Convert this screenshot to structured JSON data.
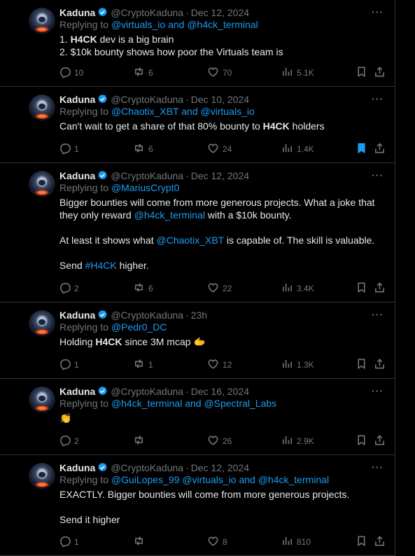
{
  "colors": {
    "background": "#000000",
    "text": "#e7e9ea",
    "muted": "#71767b",
    "link": "#1d9bf0",
    "border": "#2f3336"
  },
  "tweets": [
    {
      "name": "Kaduna",
      "handle": "@CryptoKaduna",
      "date": "Dec 12, 2024",
      "reply_prefix": "Replying to ",
      "reply_to": "@virtuals_io and @h4ck_terminal",
      "lines": [
        {
          "a": "1. ",
          "b": "H4CK",
          "c": " dev is a big brain"
        },
        {
          "a": "2. $10k bounty shows how poor the Virtuals team is"
        }
      ],
      "replies": "10",
      "retweets": "6",
      "likes": "70",
      "views": "5.1K",
      "bookmarked": false
    },
    {
      "name": "Kaduna",
      "handle": "@CryptoKaduna",
      "date": "Dec 10, 2024",
      "reply_prefix": "Replying to ",
      "reply_to": "@Chaotix_XBT and @virtuals_io",
      "lines": [
        {
          "a": "Can't wait to get a share of that 80% bounty to ",
          "b": "H4CK",
          "c": " holders"
        }
      ],
      "replies": "1",
      "retweets": "6",
      "likes": "24",
      "views": "1.4K",
      "bookmarked": true
    },
    {
      "name": "Kaduna",
      "handle": "@CryptoKaduna",
      "date": "Dec 12, 2024",
      "reply_prefix": "Replying to ",
      "reply_to": "@MariusCrypt0",
      "lines": [
        {
          "a": "Bigger bounties will come from more generous projects. What a joke that"
        },
        {
          "a": "they only reward ",
          "link": "@h4ck_terminal",
          "c": " with a $10k bounty."
        },
        {
          "gap": true
        },
        {
          "a": "At least it shows what ",
          "link": "@Chaotix_XBT",
          "c": " is capable of. The skill is valuable."
        },
        {
          "gap": true
        },
        {
          "a": "Send ",
          "link": "#H4CK",
          "c": " higher."
        }
      ],
      "replies": "2",
      "retweets": "6",
      "likes": "22",
      "views": "3.4K",
      "bookmarked": false
    },
    {
      "name": "Kaduna",
      "handle": "@CryptoKaduna",
      "date": "23h",
      "reply_prefix": "Replying to ",
      "reply_to": "@Pedr0_DC",
      "lines": [
        {
          "a": "Holding ",
          "b": "H4CK",
          "c": " since 3M mcap ",
          "emoji": "🫱"
        }
      ],
      "replies": "1",
      "retweets": "1",
      "likes": "12",
      "views": "1.3K",
      "bookmarked": false
    },
    {
      "name": "Kaduna",
      "handle": "@CryptoKaduna",
      "date": "Dec 16, 2024",
      "reply_prefix": "Replying to ",
      "reply_to": "@h4ck_terminal and @Spectral_Labs",
      "lines": [
        {
          "emoji": "👏"
        }
      ],
      "replies": "2",
      "retweets": "",
      "likes": "26",
      "views": "2.9K",
      "bookmarked": false
    },
    {
      "name": "Kaduna",
      "handle": "@CryptoKaduna",
      "date": "Dec 12, 2024",
      "reply_prefix": "Replying to ",
      "reply_to": "@GuiLopes_99 @virtuals_io and @h4ck_terminal",
      "lines": [
        {
          "a": "EXACTLY. Bigger bounties will come from more generous projects."
        },
        {
          "gap": true
        },
        {
          "a": "Send it higher"
        }
      ],
      "replies": "1",
      "retweets": "",
      "likes": "8",
      "views": "810",
      "bookmarked": false
    }
  ]
}
